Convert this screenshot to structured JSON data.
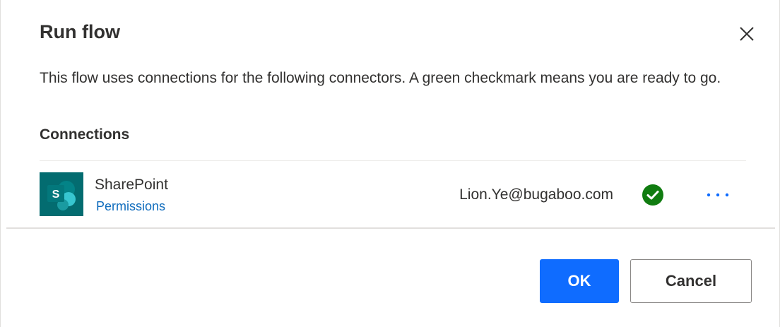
{
  "dialog": {
    "title": "Run flow",
    "description": "This flow uses connections for the following connectors. A green checkmark means you are ready to go.",
    "connections_label": "Connections"
  },
  "connections": [
    {
      "name": "SharePoint",
      "permissions_label": "Permissions",
      "account": "Lion.Ye@bugaboo.com",
      "status": "connected",
      "status_color": "#107c10",
      "logo_color": "#036c70",
      "logo_letter": "S",
      "icon": "sharepoint-icon"
    }
  ],
  "footer": {
    "ok_label": "OK",
    "cancel_label": "Cancel"
  },
  "colors": {
    "primary": "#0f6cff",
    "link": "#0f6cbd",
    "success": "#107c10"
  }
}
